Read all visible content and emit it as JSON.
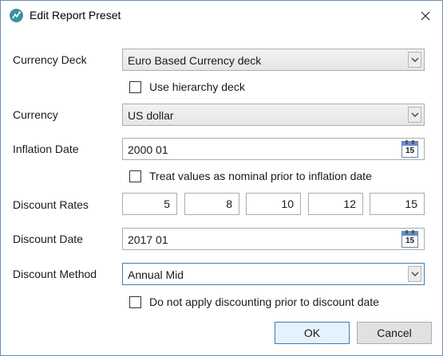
{
  "window": {
    "title": "Edit Report Preset",
    "app_icon": "app-logo-icon",
    "close_icon": "close-icon"
  },
  "currency_deck": {
    "label": "Currency Deck",
    "value": "Euro Based Currency deck",
    "use_hierarchy_label": "Use hierarchy deck",
    "use_hierarchy_checked": false
  },
  "currency": {
    "label": "Currency",
    "value": "US dollar"
  },
  "inflation_date": {
    "label": "Inflation Date",
    "value": "2000 01",
    "calendar_day": "15",
    "nominal_label": "Treat values as nominal prior to inflation date",
    "nominal_checked": false
  },
  "discount_rates": {
    "label": "Discount Rates",
    "values": [
      "5",
      "8",
      "10",
      "12",
      "15"
    ]
  },
  "discount_date": {
    "label": "Discount Date",
    "value": "2017 01",
    "calendar_day": "15"
  },
  "discount_method": {
    "label": "Discount Method",
    "value": "Annual Mid",
    "no_discount_label": "Do not apply discounting prior to discount date",
    "no_discount_checked": false
  },
  "buttons": {
    "ok": "OK",
    "cancel": "Cancel"
  }
}
